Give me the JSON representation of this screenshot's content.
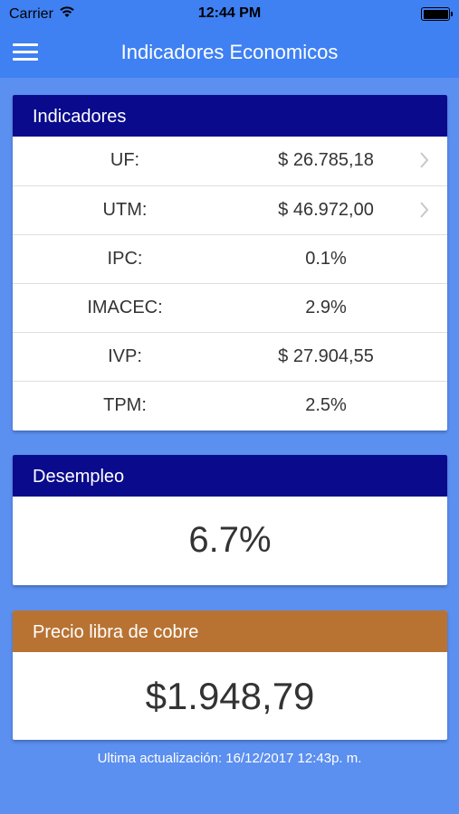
{
  "status_bar": {
    "carrier": "Carrier",
    "time": "12:44 PM"
  },
  "nav": {
    "title": "Indicadores Economicos",
    "menu_icon": "hamburger-menu-icon"
  },
  "indicadores": {
    "title": "Indicadores",
    "rows": [
      {
        "label": "UF:",
        "value": "$ 26.785,18",
        "has_chevron": true
      },
      {
        "label": "UTM:",
        "value": "$ 46.972,00",
        "has_chevron": true
      },
      {
        "label": "IPC:",
        "value": "0.1%",
        "has_chevron": false
      },
      {
        "label": "IMACEC:",
        "value": "2.9%",
        "has_chevron": false
      },
      {
        "label": "IVP:",
        "value": "$ 27.904,55",
        "has_chevron": false
      },
      {
        "label": "TPM:",
        "value": "2.5%",
        "has_chevron": false
      }
    ]
  },
  "desempleo": {
    "title": "Desempleo",
    "value": "6.7%"
  },
  "cobre": {
    "title": "Precio libra de cobre",
    "value": "$1.948,79"
  },
  "footer": {
    "text": "Ultima actualización: 16/12/2017 12:43p. m."
  },
  "colors": {
    "background": "#5b8ff0",
    "navbar": "#3f80f2",
    "header_blue": "#0a0a8c",
    "header_copper": "#b87333"
  }
}
